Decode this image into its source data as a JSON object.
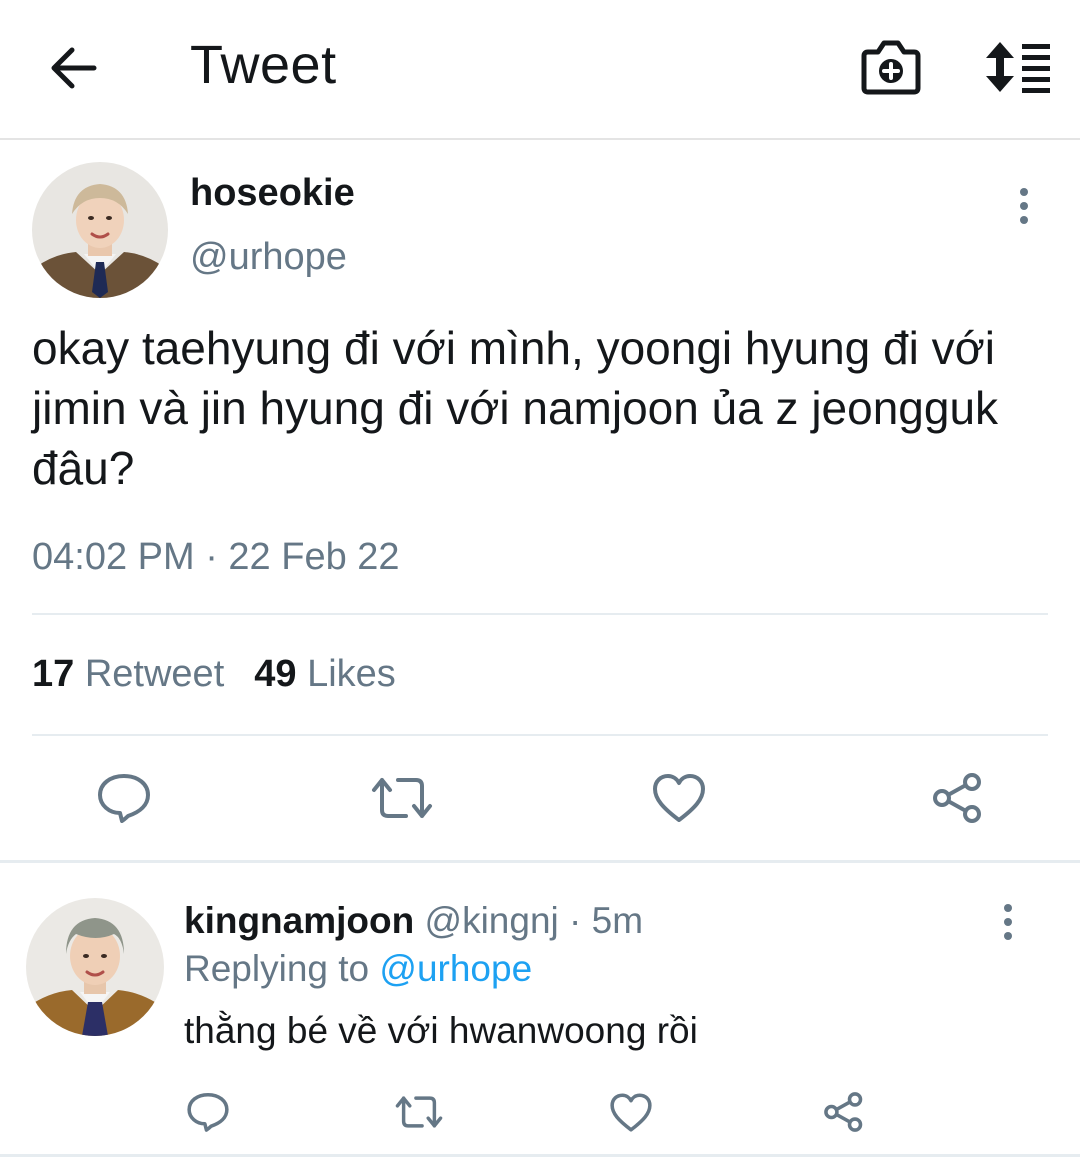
{
  "topbar": {
    "title": "Tweet",
    "back_icon": "arrow-left-icon",
    "camera_icon": "camera-add-icon",
    "sort_icon": "sort-list-icon"
  },
  "tweet": {
    "display_name": "hoseokie",
    "handle": "@urhope",
    "text": "okay taehyung đi với mình, yoongi hyung đi với jimin và jin hyung đi với namjoon ủa z jeongguk đâu?",
    "timestamp": "04:02 PM · 22 Feb 22",
    "retweet_count": "17",
    "retweet_label": "Retweet",
    "likes_count": "49",
    "likes_label": "Likes"
  },
  "reply": {
    "display_name": "kingnamjoon",
    "handle": "@kingnj",
    "time": "· 5m",
    "replying_prefix": "Replying to",
    "replying_to": "@urhope",
    "text": "thằng bé về với hwanwoong rồi"
  },
  "colors": {
    "text_primary": "#14171a",
    "text_secondary": "#657786",
    "accent": "#1da1f2",
    "divider": "#e6ecf0"
  }
}
